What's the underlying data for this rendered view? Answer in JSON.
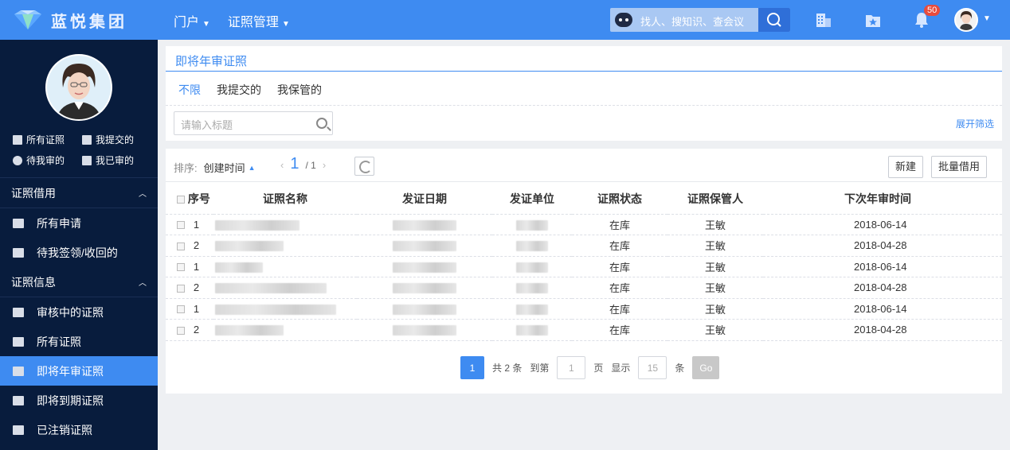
{
  "brand": {
    "name": "蓝悦集团"
  },
  "topnav": [
    {
      "label": "门户"
    },
    {
      "label": "证照管理"
    }
  ],
  "search": {
    "placeholder": "找人、搜知识、查会议"
  },
  "notifications": {
    "count": "50"
  },
  "sidebar": {
    "quick_links": [
      "所有证照",
      "我提交的",
      "待我审的",
      "我已审的"
    ],
    "sections": [
      {
        "title": "证照借用",
        "items": [
          "所有申请",
          "待我签领/收回的"
        ]
      },
      {
        "title": "证照信息",
        "items": [
          "审核中的证照",
          "所有证照",
          "即将年审证照",
          "即将到期证照",
          "已注销证照"
        ]
      }
    ]
  },
  "page": {
    "title": "即将年审证照",
    "filter_tabs": [
      "不限",
      "我提交的",
      "我保管的"
    ],
    "title_input_placeholder": "请输入标题",
    "expand_label": "展开筛选"
  },
  "toolbar": {
    "sort_label": "排序:",
    "sort_value": "创建时间",
    "page_current": "1",
    "page_total": "/ 1",
    "new_label": "新建",
    "batch_borrow_label": "批量借用"
  },
  "table": {
    "headers": [
      "序号",
      "证照名称",
      "发证日期",
      "发证单位",
      "证照状态",
      "证照保管人",
      "下次年审时间"
    ],
    "rows": [
      {
        "no": "1",
        "status": "在库",
        "keeper": "王敏",
        "next_review": "2018-06-14"
      },
      {
        "no": "2",
        "status": "在库",
        "keeper": "王敏",
        "next_review": "2018-04-28"
      },
      {
        "no": "1",
        "status": "在库",
        "keeper": "王敏",
        "next_review": "2018-06-14"
      },
      {
        "no": "2",
        "status": "在库",
        "keeper": "王敏",
        "next_review": "2018-04-28"
      },
      {
        "no": "1",
        "status": "在库",
        "keeper": "王敏",
        "next_review": "2018-06-14"
      },
      {
        "no": "2",
        "status": "在库",
        "keeper": "王敏",
        "next_review": "2018-04-28"
      }
    ]
  },
  "pagination": {
    "current": "1",
    "total_text": "共 2 条",
    "goto_label": "到第",
    "goto_value": "1",
    "page_unit": "页",
    "show_label": "显示",
    "page_size": "15",
    "size_unit": "条",
    "go_label": "Go"
  },
  "colors": {
    "primary": "#3e8bf1",
    "sidebar_bg": "#081c3d",
    "badge": "#e94b3c"
  }
}
